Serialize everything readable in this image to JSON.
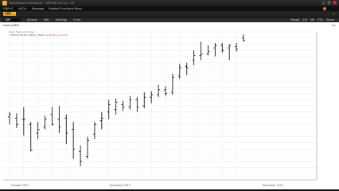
{
  "window": {
    "title": "Bloomberg Professional - GBPUSD Curncy - GP",
    "controls": [
      "–",
      "□",
      "×"
    ]
  },
  "menubar": {
    "items": [
      "GBP+C",
      "<GO>",
      "Message",
      "Related Functions Menu"
    ]
  },
  "tab": {
    "label": "GBP",
    "close_label": "×"
  },
  "toolbar": {
    "ticker": "GBP",
    "items": [
      "Actions",
      "Edit",
      "Settings"
    ],
    "highlight": "Chart",
    "right_items": [
      "Range",
      "1M",
      "3M",
      "YTD",
      "Zoom"
    ]
  },
  "chart": {
    "label": "Cable (GBP)",
    "range_text": "Bid",
    "legend": {
      "line1": "Open   High   Low   Close",
      "line2": "1.5452   1.5640   1.5451   1.5622",
      "change": "+0.0171 (+1.11%)"
    }
  },
  "chart_data": {
    "type": "ohlc",
    "x_labels": [
      "October 2013",
      "November 2013",
      "December 2013"
    ],
    "y_range": [
      1.515,
      1.635
    ],
    "bars": [
      {
        "open": 1.566,
        "high": 1.57,
        "low": 1.56,
        "close": 1.568
      },
      {
        "open": 1.565,
        "high": 1.569,
        "low": 1.557,
        "close": 1.56
      },
      {
        "open": 1.564,
        "high": 1.574,
        "low": 1.551,
        "close": 1.564
      },
      {
        "open": 1.56,
        "high": 1.562,
        "low": 1.538,
        "close": 1.539
      },
      {
        "open": 1.553,
        "high": 1.562,
        "low": 1.548,
        "close": 1.556
      },
      {
        "open": 1.558,
        "high": 1.567,
        "low": 1.556,
        "close": 1.564
      },
      {
        "open": 1.568,
        "high": 1.574,
        "low": 1.559,
        "close": 1.56
      },
      {
        "open": 1.564,
        "high": 1.575,
        "low": 1.553,
        "close": 1.558
      },
      {
        "open": 1.565,
        "high": 1.568,
        "low": 1.544,
        "close": 1.553
      },
      {
        "open": 1.556,
        "high": 1.562,
        "low": 1.532,
        "close": 1.54
      },
      {
        "open": 1.538,
        "high": 1.543,
        "low": 1.526,
        "close": 1.53
      },
      {
        "open": 1.534,
        "high": 1.55,
        "low": 1.532,
        "close": 1.547
      },
      {
        "open": 1.552,
        "high": 1.562,
        "low": 1.548,
        "close": 1.56
      },
      {
        "open": 1.563,
        "high": 1.57,
        "low": 1.556,
        "close": 1.565
      },
      {
        "open": 1.57,
        "high": 1.58,
        "low": 1.564,
        "close": 1.576
      },
      {
        "open": 1.572,
        "high": 1.581,
        "low": 1.568,
        "close": 1.578
      },
      {
        "open": 1.576,
        "high": 1.579,
        "low": 1.571,
        "close": 1.574
      },
      {
        "open": 1.574,
        "high": 1.583,
        "low": 1.572,
        "close": 1.58
      },
      {
        "open": 1.58,
        "high": 1.582,
        "low": 1.57,
        "close": 1.574
      },
      {
        "open": 1.575,
        "high": 1.586,
        "low": 1.573,
        "close": 1.582
      },
      {
        "open": 1.582,
        "high": 1.587,
        "low": 1.577,
        "close": 1.584
      },
      {
        "open": 1.584,
        "high": 1.592,
        "low": 1.582,
        "close": 1.588
      },
      {
        "open": 1.588,
        "high": 1.591,
        "low": 1.583,
        "close": 1.585
      },
      {
        "open": 1.586,
        "high": 1.601,
        "low": 1.584,
        "close": 1.598
      },
      {
        "open": 1.599,
        "high": 1.609,
        "low": 1.597,
        "close": 1.606
      },
      {
        "open": 1.607,
        "high": 1.61,
        "low": 1.6,
        "close": 1.606
      },
      {
        "open": 1.612,
        "high": 1.62,
        "low": 1.608,
        "close": 1.616
      },
      {
        "open": 1.616,
        "high": 1.627,
        "low": 1.612,
        "close": 1.617
      },
      {
        "open": 1.617,
        "high": 1.624,
        "low": 1.616,
        "close": 1.619
      },
      {
        "open": 1.622,
        "high": 1.626,
        "low": 1.615,
        "close": 1.624
      },
      {
        "open": 1.624,
        "high": 1.626,
        "low": 1.618,
        "close": 1.62
      },
      {
        "open": 1.622,
        "high": 1.625,
        "low": 1.612,
        "close": 1.624
      },
      {
        "open": 1.623,
        "high": 1.626,
        "low": 1.619,
        "close": 1.621
      },
      {
        "open": 1.63,
        "high": 1.633,
        "low": 1.627,
        "close": 1.628
      }
    ]
  }
}
